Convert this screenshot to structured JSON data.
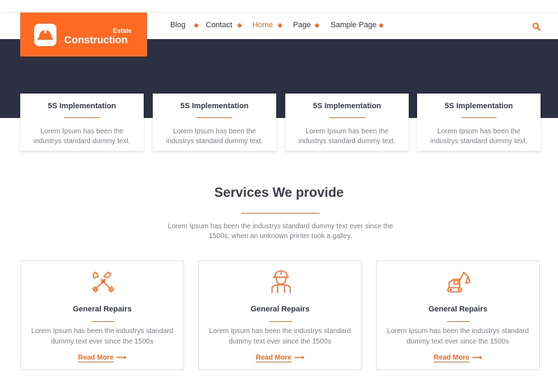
{
  "brand": {
    "estate": "Estate",
    "name": "Construction",
    "accent": "#ff6a22",
    "logo_icon": "hard-hat-icon"
  },
  "nav": {
    "items": [
      {
        "label": "Blog",
        "active": false
      },
      {
        "label": "Contact",
        "active": false
      },
      {
        "label": "Home",
        "active": true
      },
      {
        "label": "Page",
        "active": false
      },
      {
        "label": "Sample Page",
        "active": false
      }
    ],
    "search_icon": "search-icon"
  },
  "hero": {
    "background": "#2b3142"
  },
  "features": [
    {
      "title": "5S Implementation",
      "text": "Lorem Ipsum has been the industrys standard dummy text."
    },
    {
      "title": "5S Implementation",
      "text": "Lorem Ipsum has been the industrys standard dummy text."
    },
    {
      "title": "5S Implementation",
      "text": "Lorem Ipsum has been the industrys standard dummy text."
    },
    {
      "title": "5S Implementation",
      "text": "Lorem Ipsum has been the industrys standard dummy text."
    }
  ],
  "services": {
    "title": "Services We provide",
    "subtitle": "Lorem Ipsum has been the industrys standard dummy text ever since the 1500s, when an unknown printer took a galley.",
    "cards": [
      {
        "icon": "tools-icon",
        "title": "General Repairs",
        "text": "Lorem Ipsum has been the industrys standard dummy text ever since the 1500s",
        "link": "Read More"
      },
      {
        "icon": "worker-icon",
        "title": "General Repairs",
        "text": "Lorem Ipsum has been the industrys standard dummy text ever since the 1500s",
        "link": "Read More"
      },
      {
        "icon": "excavator-icon",
        "title": "General Repairs",
        "text": "Lorem Ipsum has been the industrys standard dummy text ever since the 1500s",
        "link": "Read More"
      }
    ]
  }
}
